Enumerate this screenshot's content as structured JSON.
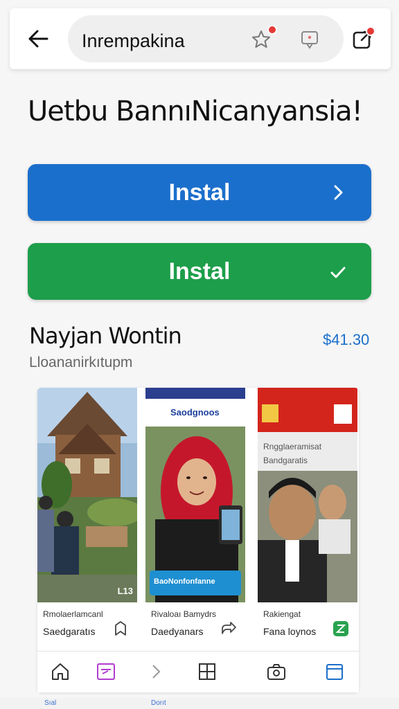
{
  "header": {
    "search_text": "Inrempakina",
    "icons": [
      "back-arrow-icon",
      "star-icon",
      "chat-icon",
      "open-external-icon"
    ],
    "badge_color": "#e53935"
  },
  "headline": "Uetbu BannıNicanyansia!",
  "buttons": [
    {
      "label": "Instal",
      "color": "#1b6fcc",
      "icon": "chevron-right-icon"
    },
    {
      "label": "Instal",
      "color": "#1d9e4a",
      "icon": "check-icon"
    }
  ],
  "app": {
    "title": "Nayjan Wontin",
    "subtitle": "Lloananirkıtupm",
    "price": "$41.30"
  },
  "screenshots": [
    {
      "top_label": "",
      "caption1": "Rmolaerlamcanl",
      "caption2": "Saedgaratıs",
      "icon": "bookmark-icon",
      "overlay": "L13"
    },
    {
      "top_label": "Saodgnoos",
      "caption1": "Rivaloaı Bamydrs",
      "caption2": "Daedyanars",
      "icon": "share-icon",
      "overlay": "BaoNonfonfanne"
    },
    {
      "top_label": "Rngglaeramisat",
      "top_label2": "Bandgaratis",
      "caption1": "Rakiengat",
      "caption2": "Fana loynos",
      "icon": "app-badge-icon"
    }
  ],
  "nav": [
    "home-icon",
    "edit-icon",
    "chevron-right-icon",
    "grid-icon",
    "camera-icon",
    "window-icon"
  ],
  "bottom_strip": [
    "Sıal",
    "Dorıt"
  ]
}
